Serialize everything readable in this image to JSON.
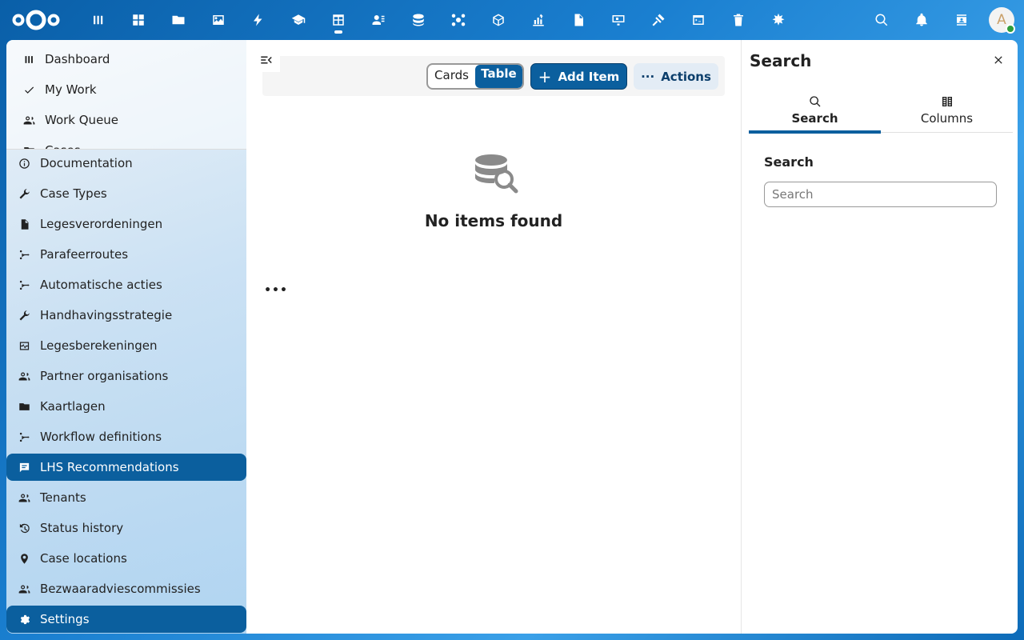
{
  "header": {
    "app_icons": [
      {
        "name": "dashboard-icon"
      },
      {
        "name": "grid-icon"
      },
      {
        "name": "folder-icon"
      },
      {
        "name": "photos-icon"
      },
      {
        "name": "activity-icon"
      },
      {
        "name": "education-icon"
      },
      {
        "name": "tables-icon",
        "active": true
      },
      {
        "name": "contacts-icon"
      },
      {
        "name": "database-icon"
      },
      {
        "name": "network-icon"
      },
      {
        "name": "cube-icon"
      },
      {
        "name": "chart-icon"
      },
      {
        "name": "document-icon"
      },
      {
        "name": "presentation-icon"
      },
      {
        "name": "gavel-icon"
      },
      {
        "name": "code-icon"
      },
      {
        "name": "trash-icon"
      },
      {
        "name": "settings-star-icon"
      }
    ],
    "avatar_letter": "A"
  },
  "sidebar": {
    "top_items": [
      {
        "label": "Dashboard",
        "icon": "chart-bars-icon"
      },
      {
        "label": "My Work",
        "icon": "check-icon"
      },
      {
        "label": "Work Queue",
        "icon": "users-icon"
      },
      {
        "label": "Cases",
        "icon": "folder-icon"
      }
    ],
    "items": [
      {
        "label": "Documentation",
        "icon": "info-icon"
      },
      {
        "label": "Case Types",
        "icon": "wrench-icon"
      },
      {
        "label": "Legesverordeningen",
        "icon": "file-icon"
      },
      {
        "label": "Parafeerroutes",
        "icon": "route-icon"
      },
      {
        "label": "Automatische acties",
        "icon": "route-icon"
      },
      {
        "label": "Handhavingsstrategie",
        "icon": "wrench-icon"
      },
      {
        "label": "Legesberekeningen",
        "icon": "pulse-icon"
      },
      {
        "label": "Partner organisations",
        "icon": "users-icon"
      },
      {
        "label": "Kaartlagen",
        "icon": "folder-icon"
      },
      {
        "label": "Workflow definitions",
        "icon": "route-icon"
      },
      {
        "label": "LHS Recommendations",
        "icon": "message-icon",
        "active": true
      },
      {
        "label": "Tenants",
        "icon": "users-icon"
      },
      {
        "label": "Status history",
        "icon": "history-icon"
      },
      {
        "label": "Case locations",
        "icon": "pin-icon"
      },
      {
        "label": "Bezwaaradviescommissies",
        "icon": "users-icon"
      },
      {
        "label": "Settings",
        "icon": "gear-icon",
        "active": true
      }
    ]
  },
  "main": {
    "view_options": [
      "Cards",
      "Table"
    ],
    "selected_view": "Table",
    "add_button": "Add Item",
    "actions_button": "Actions",
    "empty_title": "No items found"
  },
  "panel": {
    "title": "Search",
    "tabs": [
      {
        "label": "Search",
        "icon": "search-icon",
        "active": true
      },
      {
        "label": "Columns",
        "icon": "columns-icon"
      }
    ],
    "field_label": "Search",
    "search_placeholder": "Search"
  },
  "colors": {
    "primary": "#0b5f9e",
    "header_bg": "#0a5fa8"
  }
}
